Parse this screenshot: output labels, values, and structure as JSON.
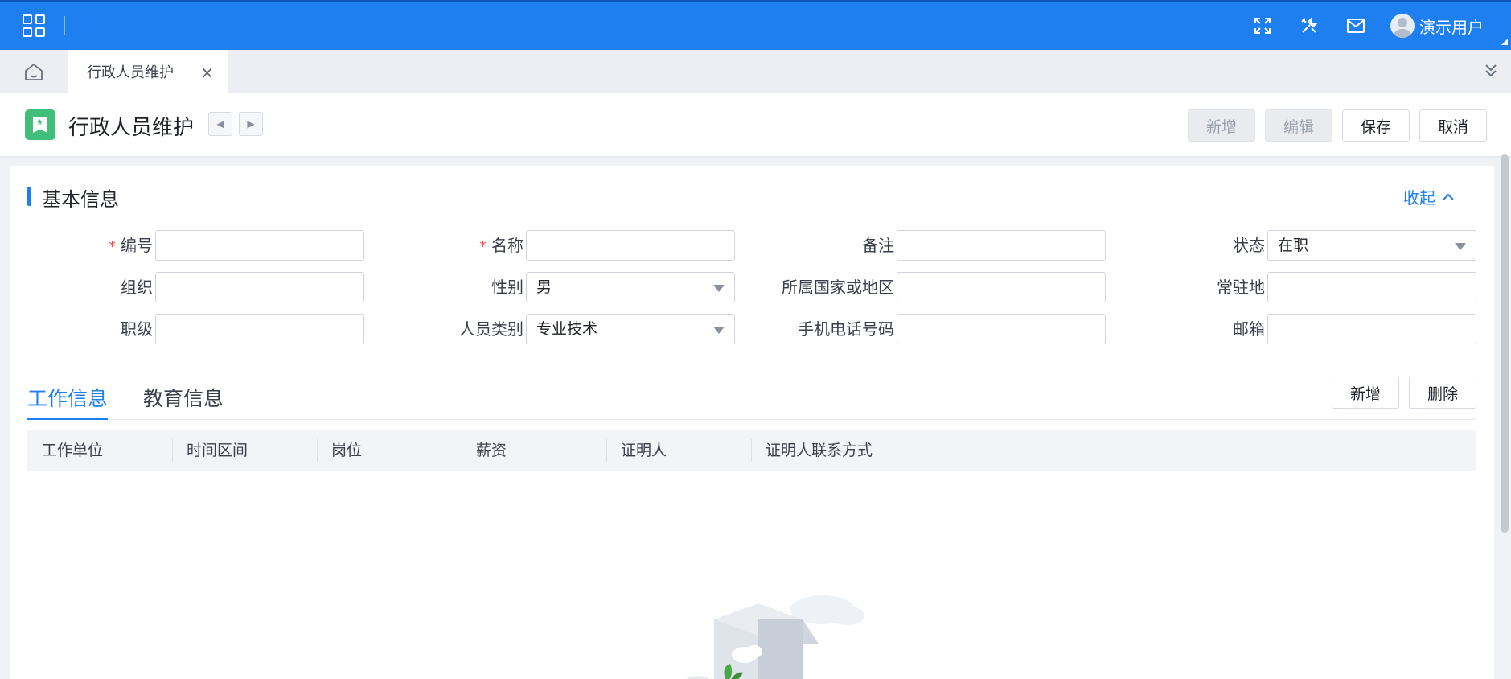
{
  "topbar": {
    "icons": [
      "apps-grid-icon",
      "fullscreen-icon",
      "tools-icon",
      "mail-icon"
    ],
    "user_name": "演示用户"
  },
  "tabs": {
    "home_icon": "home-icon",
    "open_tab": "行政人员维护",
    "close_symbol": "×"
  },
  "header": {
    "title": "行政人员维护",
    "prev_symbol": "◀",
    "next_symbol": "▶",
    "buttons": {
      "add": "新增",
      "edit": "编辑",
      "save": "保存",
      "cancel": "取消"
    }
  },
  "basic_info": {
    "title": "基本信息",
    "collapse_label": "收起",
    "required_mark": "*",
    "fields": {
      "code": {
        "label": "编号",
        "value": ""
      },
      "name": {
        "label": "名称",
        "value": ""
      },
      "remark": {
        "label": "备注",
        "value": ""
      },
      "status": {
        "label": "状态",
        "value": "在职"
      },
      "org": {
        "label": "组织",
        "value": ""
      },
      "gender": {
        "label": "性别",
        "value": "男"
      },
      "country": {
        "label": "所属国家或地区",
        "value": ""
      },
      "residence": {
        "label": "常驻地",
        "value": ""
      },
      "rank": {
        "label": "职级",
        "value": ""
      },
      "category": {
        "label": "人员类别",
        "value": "专业技术"
      },
      "phone": {
        "label": "手机电话号码",
        "value": ""
      },
      "email": {
        "label": "邮箱",
        "value": ""
      }
    }
  },
  "detail_tabs": {
    "work": "工作信息",
    "education": "教育信息",
    "add": "新增",
    "delete": "删除"
  },
  "table": {
    "columns": [
      "工作单位",
      "时间区间",
      "岗位",
      "薪资",
      "证明人",
      "证明人联系方式"
    ],
    "rows": []
  },
  "colors": {
    "primary": "#1d7ff0",
    "page_icon": "#3fbf7a",
    "required": "#f04a4a"
  }
}
